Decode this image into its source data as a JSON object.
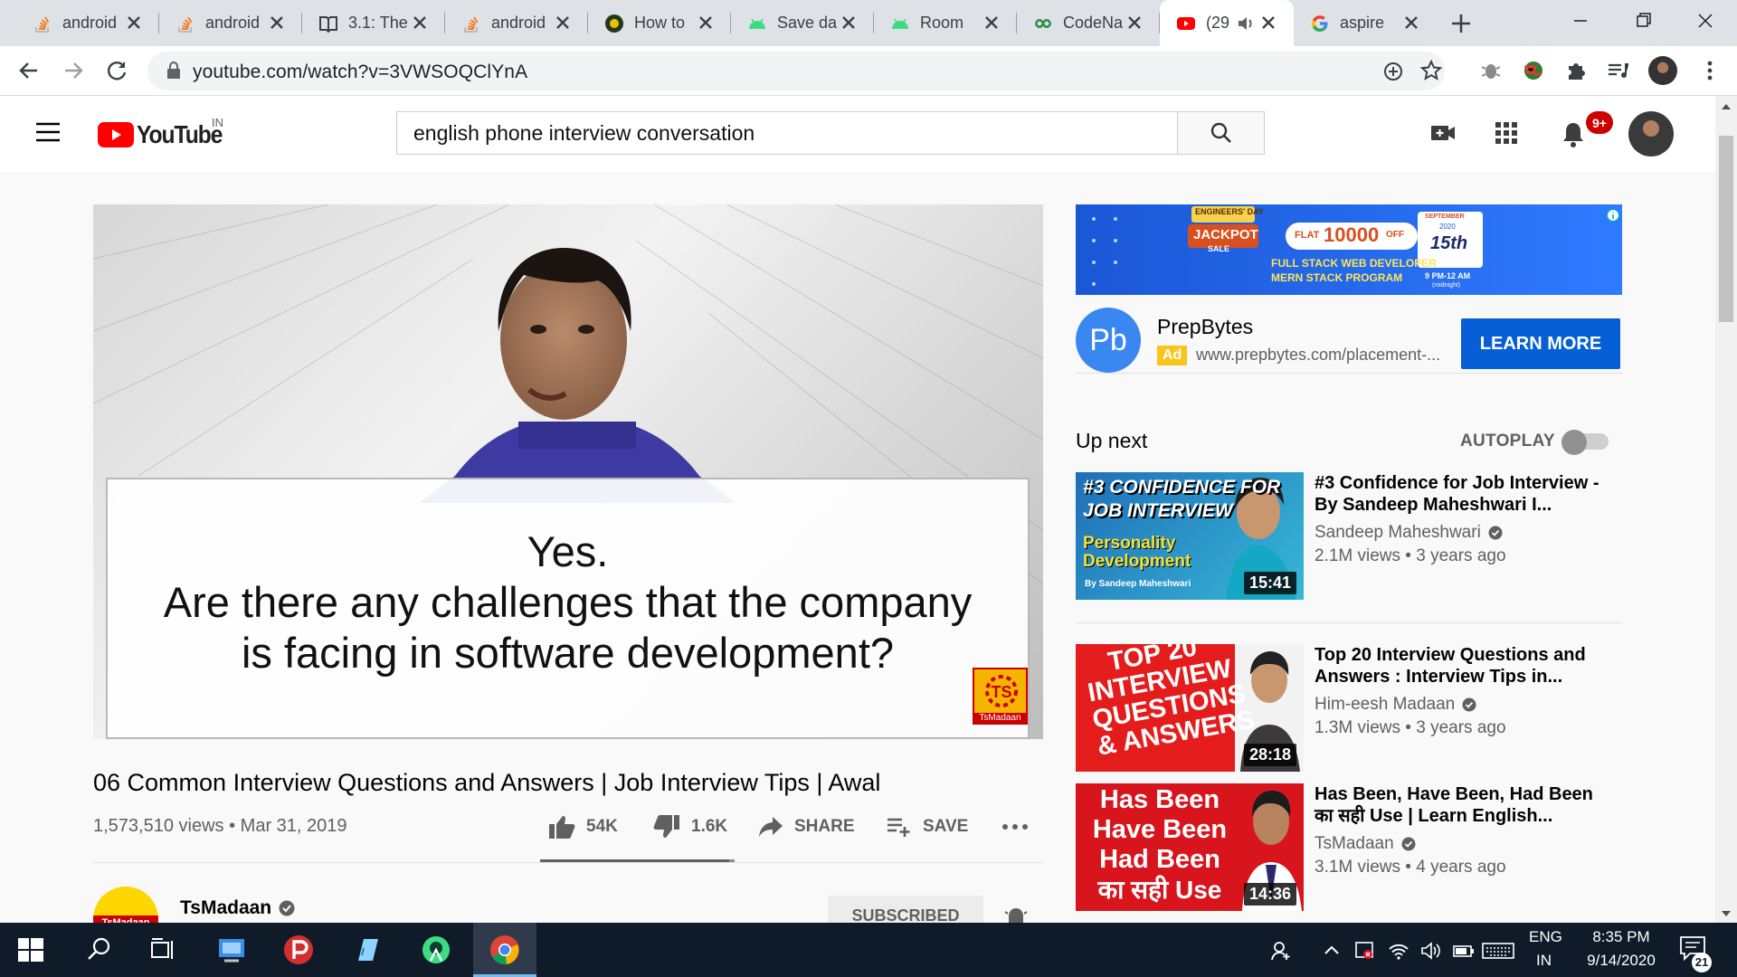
{
  "browser": {
    "tabs": [
      {
        "title": "android",
        "favicon": "stackoverflow-icon"
      },
      {
        "title": "android",
        "favicon": "stackoverflow-icon"
      },
      {
        "title": "3.1: The",
        "favicon": "book-icon"
      },
      {
        "title": "android",
        "favicon": "stackoverflow-icon"
      },
      {
        "title": "How to",
        "favicon": "site-icon"
      },
      {
        "title": "Save da",
        "favicon": "android-icon"
      },
      {
        "title": "Room",
        "favicon": "android-icon"
      },
      {
        "title": "CodeNa",
        "favicon": "codechef-icon"
      },
      {
        "title": "(29",
        "favicon": "youtube-icon",
        "active": true,
        "audio": true
      },
      {
        "title": "aspire",
        "favicon": "google-icon"
      }
    ],
    "url": "youtube.com/watch?v=3VWSOQClYnA"
  },
  "youtube": {
    "logo_text": "YouTube",
    "country": "IN",
    "search_value": "english phone interview conversation",
    "notification_count": "9+"
  },
  "player": {
    "caption_line1": "Yes.",
    "caption_line2": "Are there any challenges that the company",
    "caption_line3": "is facing in software development?",
    "channel_logo": "TsMadaan"
  },
  "video": {
    "title": "06 Common Interview Questions and Answers | Job Interview Tips | Awal",
    "views_date": "1,573,510 views • Mar 31, 2019",
    "likes": "54K",
    "dislikes": "1.6K",
    "share_label": "SHARE",
    "save_label": "SAVE",
    "like_ratio": 0.97,
    "channel": {
      "name": "TsMadaan",
      "avatar_text": "TsMadaan",
      "subscribe_label": "SUBSCRIBED"
    }
  },
  "ad": {
    "banner": {
      "badge": "ENGINEERS' DAY",
      "jackpot": "JACKPOT",
      "sale": "SALE",
      "discount_prefix": "FLAT",
      "discount": "10000",
      "discount_suffix": "OFF",
      "line1": "FULL STACK WEB DEVELOPER",
      "line2": "MERN STACK PROGRAM",
      "month": "SEPTEMBER",
      "year": "2020",
      "date": "15th",
      "time": "9 PM-12 AM",
      "time_note": "(midnight)"
    },
    "logo_text": "Pb",
    "advertiser": "PrepBytes",
    "badge": "Ad",
    "url": "www.prepbytes.com/placement-...",
    "cta": "LEARN MORE"
  },
  "sidebar": {
    "up_next_label": "Up next",
    "autoplay_label": "AUTOPLAY",
    "autoplay_on": false,
    "recommendations": [
      {
        "title": "#3 Confidence for Job Interview - By Sandeep Maheshwari I...",
        "channel": "Sandeep Maheshwari",
        "verified": true,
        "meta": "2.1M views • 3 years ago",
        "duration": "15:41",
        "thumb_lines": [
          "#3 CONFIDENCE FOR",
          "JOB INTERVIEW",
          "Personality",
          "Development",
          "By Sandeep Maheshwari"
        ]
      },
      {
        "title": "Top 20 Interview Questions and Answers : Interview Tips in...",
        "channel": "Him-eesh Madaan",
        "verified": true,
        "meta": "1.3M views • 3 years ago",
        "duration": "28:18",
        "thumb_lines": [
          "TOP 20",
          "INTERVIEW",
          "QUESTIONS",
          "& ANSWERS"
        ]
      },
      {
        "title": "Has Been, Have Been, Had Been का सही Use | Learn English...",
        "channel": "TsMadaan",
        "verified": true,
        "meta": "3.1M views • 4 years ago",
        "duration": "14:36",
        "thumb_lines": [
          "Has Been",
          "Have Been",
          "Had Been",
          "का सही Use"
        ]
      }
    ]
  },
  "taskbar": {
    "lang": "ENG",
    "region": "IN",
    "time": "8:35 PM",
    "date": "9/14/2020",
    "notifications": "21"
  }
}
